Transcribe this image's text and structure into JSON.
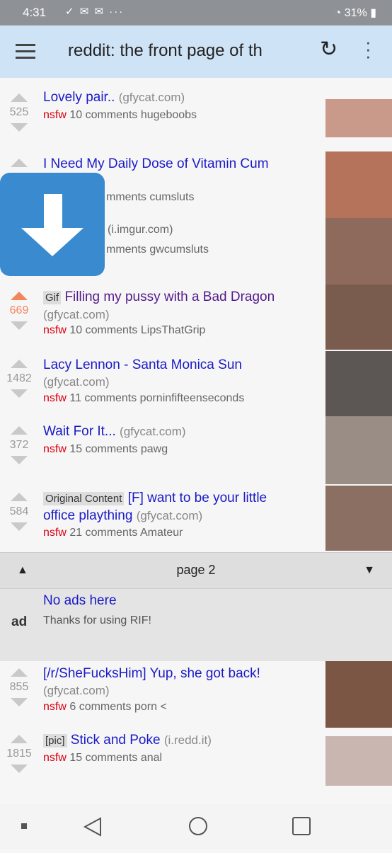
{
  "status_bar": {
    "time": "4:31",
    "notif_icons": "check-icon mail-icon mail-icon more-icon",
    "battery": "31%"
  },
  "appbar": {
    "title": "reddit: the front page of th"
  },
  "posts": [
    {
      "score": "525",
      "title": "Lovely pair..",
      "domain": "(gfycat.com)",
      "nsfw": "nsfw",
      "comments": "10 comments",
      "subreddit": "hugeboobs"
    },
    {
      "title": "I Need My Daily Dose of Vitamin Cum",
      "comments": "mments",
      "subreddit": "cumsluts"
    },
    {
      "domain": "(i.imgur.com)",
      "comments": "mments",
      "subreddit": "gwcumsluts"
    },
    {
      "score": "669",
      "tag": "Gif",
      "title": "Filling my pussy with a Bad Dragon",
      "domain": "(gfycat.com)",
      "nsfw": "nsfw",
      "comments": "10 comments",
      "subreddit": "LipsThatGrip"
    },
    {
      "score": "1482",
      "title": "Lacy Lennon - Santa Monica Sun",
      "domain": "(gfycat.com)",
      "nsfw": "nsfw",
      "comments": "11 comments",
      "subreddit": "porninfifteenseconds"
    },
    {
      "score": "372",
      "title": "Wait For It...",
      "domain": "(gfycat.com)",
      "nsfw": "nsfw",
      "comments": "15 comments",
      "subreddit": "pawg"
    },
    {
      "score": "584",
      "tag": "Original Content",
      "title_a": "[F] want to be your little",
      "title_b": "office plaything",
      "domain": "(gfycat.com)",
      "nsfw": "nsfw",
      "comments": "21 comments",
      "subreddit": "Amateur"
    },
    {
      "score": "855",
      "title": "[/r/SheFucksHim] Yup, she got back!",
      "domain": "(gfycat.com)",
      "nsfw": "nsfw",
      "comments": "6 comments",
      "subreddit": "porn"
    },
    {
      "score": "1815",
      "tag": "[pic]",
      "title": "Stick and Poke",
      "domain": "(i.redd.it)",
      "nsfw": "nsfw",
      "comments": "15 comments",
      "subreddit": "anal"
    }
  ],
  "pager": {
    "label": "page 2"
  },
  "ad": {
    "label": "ad",
    "title": "No ads here",
    "subtitle": "Thanks for using RIF!"
  },
  "colors": {
    "link": "#1a1ac8",
    "visited": "#551a8b",
    "nsfw": "#dd0011",
    "upvote": "#f4845e",
    "appbar": "#cfe3f6"
  }
}
